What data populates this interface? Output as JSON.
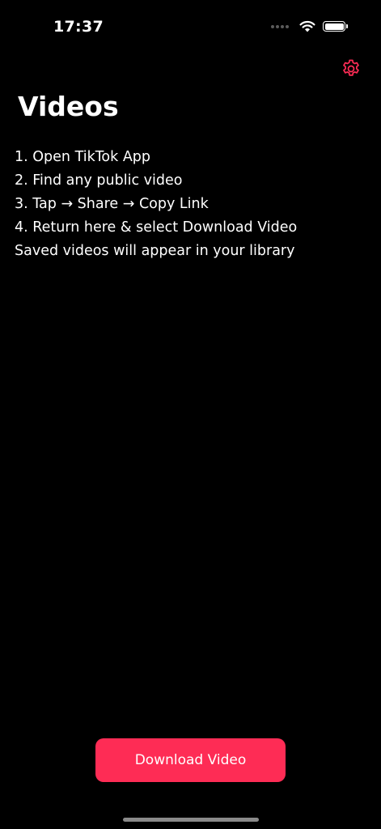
{
  "status_bar": {
    "time": "17:37"
  },
  "header": {
    "title": "Videos",
    "settings_icon": "gear-icon"
  },
  "instructions": [
    "1. Open TikTok App",
    "2. Find any public video",
    "3. Tap → Share → Copy Link",
    "4. Return here & select Download Video",
    "Saved videos will appear in your library"
  ],
  "actions": {
    "download_label": "Download Video"
  },
  "colors": {
    "background": "#000000",
    "accent": "#fe2c55",
    "text": "#ffffff"
  }
}
